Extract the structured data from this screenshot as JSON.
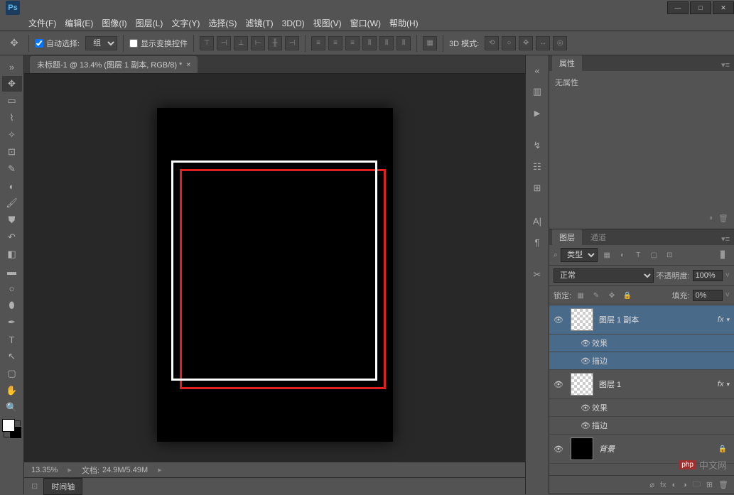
{
  "app": {
    "logo": "Ps"
  },
  "window_controls": {
    "min": "—",
    "max": "□",
    "close": "✕"
  },
  "menu": [
    "文件(F)",
    "编辑(E)",
    "图像(I)",
    "图层(L)",
    "文字(Y)",
    "选择(S)",
    "滤镜(T)",
    "3D(D)",
    "视图(V)",
    "窗口(W)",
    "帮助(H)"
  ],
  "options": {
    "auto_select_label": "自动选择:",
    "auto_select_value": "组",
    "show_transform_label": "显示变换控件",
    "mode_3d_label": "3D 模式:"
  },
  "document": {
    "tab_title": "未标题-1 @ 13.4% (图层 1 副本, RGB/8) *",
    "zoom": "13.35%",
    "doc_info_label": "文档:",
    "doc_info_value": "24.9M/5.49M"
  },
  "timeline": {
    "label": "时间轴"
  },
  "panels": {
    "properties": {
      "tab": "属性",
      "empty_text": "无属性"
    },
    "layers": {
      "tab_layers": "图层",
      "tab_channels": "通道",
      "kind_label": "类型",
      "blend_mode": "正常",
      "opacity_label": "不透明度:",
      "opacity_value": "100%",
      "lock_label": "锁定:",
      "fill_label": "填充:",
      "fill_value": "0%",
      "items": [
        {
          "name": "图层 1 副本",
          "selected": true,
          "fx": true,
          "effects": [
            {
              "label": "效果"
            },
            {
              "label": "描边"
            }
          ]
        },
        {
          "name": "图层 1",
          "selected": false,
          "fx": true,
          "effects": [
            {
              "label": "效果"
            },
            {
              "label": "描边"
            }
          ]
        },
        {
          "name": "背景",
          "selected": false,
          "locked": true
        }
      ]
    }
  },
  "watermark": {
    "logo": "php",
    "text": "中文网"
  }
}
